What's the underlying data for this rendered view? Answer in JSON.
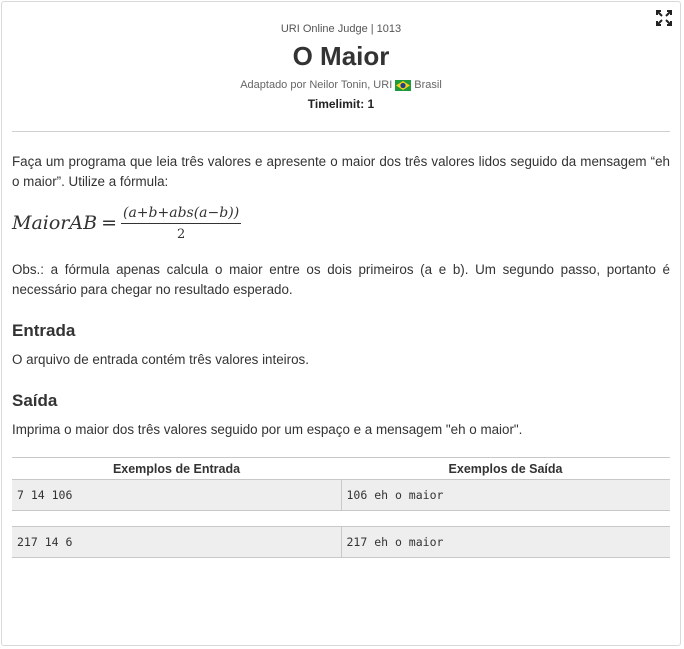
{
  "header": {
    "judge_line": "URI Online Judge | 1013",
    "title": "O Maior",
    "adapted_by": "Adaptado por Neilor Tonin, URI",
    "country": "Brasil",
    "timelimit": "Timelimit: 1"
  },
  "problem": {
    "description": "Faça um programa que leia três valores e apresente o maior dos três valores lidos seguido da mensagem “eh o maior”. Utilize a fórmula:",
    "formula": {
      "lhs": "MaiorAB",
      "eq": "=",
      "numerator": "(a+b+abs(a−b))",
      "denominator": "2"
    },
    "obs": "Obs.: a fórmula apenas calcula o maior entre os dois primeiros (a e b). Um segundo passo, portanto é necessário para chegar no resultado esperado."
  },
  "input_section": {
    "heading": "Entrada",
    "text": "O arquivo de entrada contém três valores inteiros."
  },
  "output_section": {
    "heading": "Saída",
    "text": "Imprima o maior dos três valores seguido por um espaço e a mensagem \"eh o maior\"."
  },
  "examples": {
    "input_header": "Exemplos de Entrada",
    "output_header": "Exemplos de Saída",
    "rows": [
      {
        "input": "7 14 106",
        "output": "106 eh o maior"
      },
      {
        "input": "217 14 6",
        "output": "217 eh o maior"
      }
    ]
  },
  "icons": {
    "expand": "expand-icon",
    "flag": "brazil-flag-icon"
  },
  "colors": {
    "text": "#333333",
    "example_bg": "#eeeeee",
    "border": "#c8c8c8"
  }
}
